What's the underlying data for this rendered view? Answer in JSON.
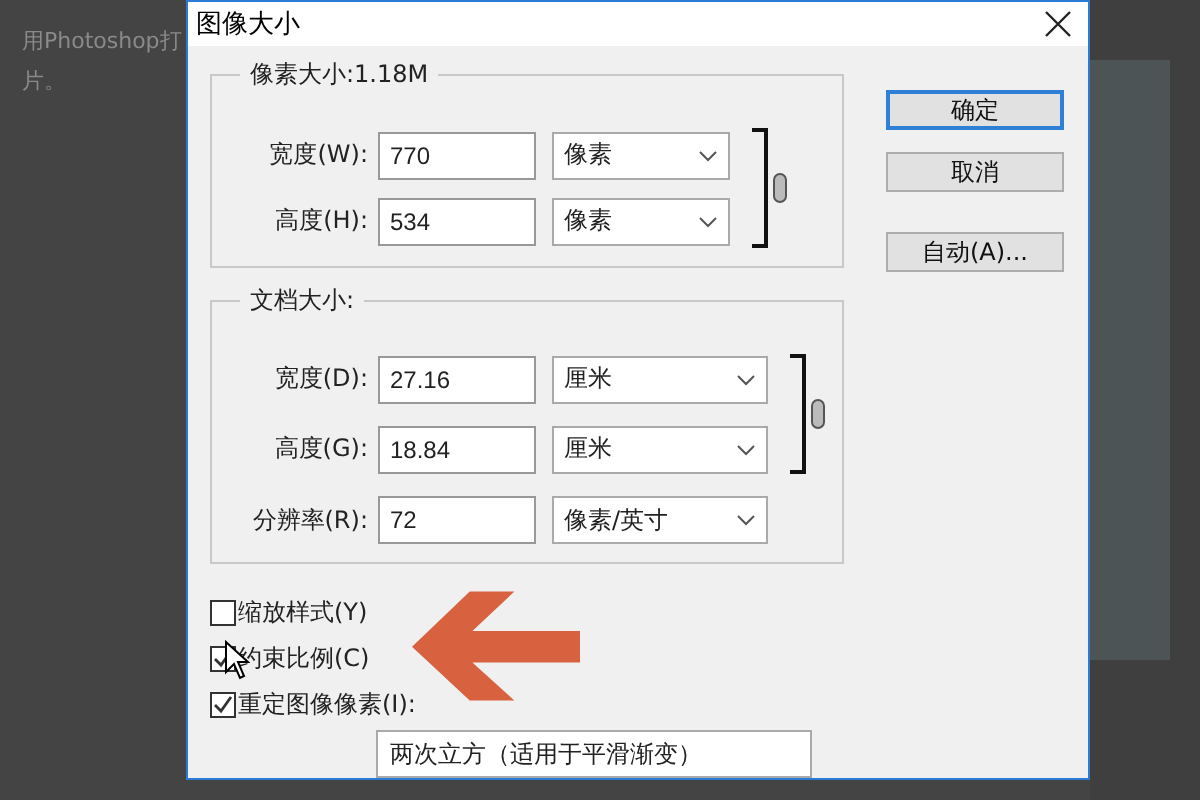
{
  "background_text": [
    "用Photoshop打",
    "片。"
  ],
  "window": {
    "title": "图像大小"
  },
  "pixel_dimensions": {
    "title": "像素大小:1.18M",
    "rows": [
      {
        "label": "宽度(W):",
        "value": "770",
        "unit": "像素"
      },
      {
        "label": "高度(H):",
        "value": "534",
        "unit": "像素"
      }
    ]
  },
  "document_size": {
    "title": "文档大小:",
    "rows": [
      {
        "label": "宽度(D):",
        "value": "27.16",
        "unit": "厘米",
        "linked": true
      },
      {
        "label": "高度(G):",
        "value": "18.84",
        "unit": "厘米",
        "linked": true
      },
      {
        "label": "分辨率(R):",
        "value": "72",
        "unit": "像素/英寸",
        "linked": false
      }
    ]
  },
  "buttons": [
    {
      "label": "确定",
      "default": true
    },
    {
      "label": "取消",
      "default": false
    },
    {
      "label": "自动(A)...",
      "default": false
    }
  ],
  "checkboxes": [
    {
      "label": "缩放样式(Y)",
      "checked": false
    },
    {
      "label": "约束比例(C)",
      "checked": true
    },
    {
      "label": "重定图像像素(I):",
      "checked": true
    }
  ],
  "resample": {
    "value": "两次立方（适用于平滑渐变）"
  }
}
